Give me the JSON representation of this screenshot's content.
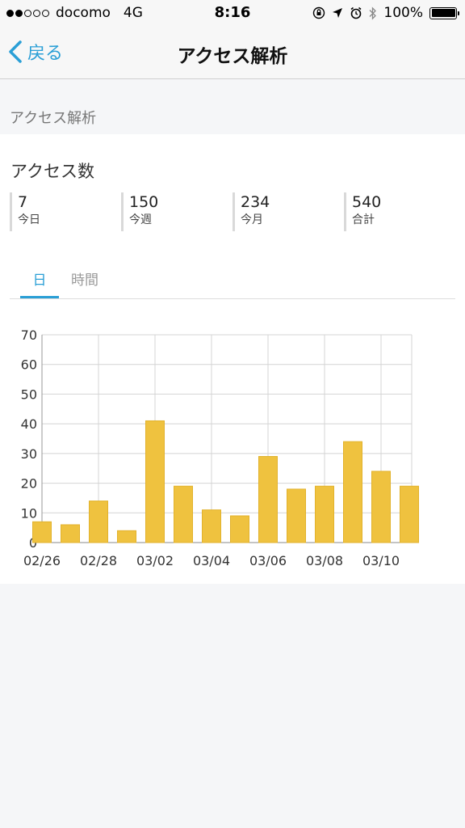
{
  "status_bar": {
    "carrier": "docomo",
    "network": "4G",
    "time": "8:16",
    "battery": "100%"
  },
  "nav": {
    "back_label": "戻る",
    "title": "アクセス解析"
  },
  "section": {
    "header": "アクセス解析"
  },
  "card": {
    "title": "アクセス数",
    "stats": [
      {
        "value": "7",
        "label": "今日"
      },
      {
        "value": "150",
        "label": "今週"
      },
      {
        "value": "234",
        "label": "今月"
      },
      {
        "value": "540",
        "label": "合計"
      }
    ],
    "tabs": [
      {
        "label": "日",
        "active": true
      },
      {
        "label": "時間",
        "active": false
      }
    ]
  },
  "colors": {
    "accent": "#2a9fd6",
    "bar": "#efc23f"
  },
  "chart_data": {
    "type": "bar",
    "categories": [
      "02/26",
      "02/27",
      "02/28",
      "03/01",
      "03/02",
      "03/03",
      "03/04",
      "03/05",
      "03/06",
      "03/07",
      "03/08",
      "03/09",
      "03/10",
      "03/11"
    ],
    "values": [
      7,
      6,
      14,
      4,
      41,
      19,
      11,
      9,
      29,
      18,
      19,
      34,
      24,
      19
    ],
    "x_tick_labels": [
      "02/26",
      "02/28",
      "03/02",
      "03/04",
      "03/06",
      "03/08",
      "03/10"
    ],
    "y_ticks": [
      0,
      10,
      20,
      30,
      40,
      50,
      60,
      70
    ],
    "ylim": [
      0,
      70
    ],
    "grid": true,
    "title": "",
    "xlabel": "",
    "ylabel": ""
  }
}
